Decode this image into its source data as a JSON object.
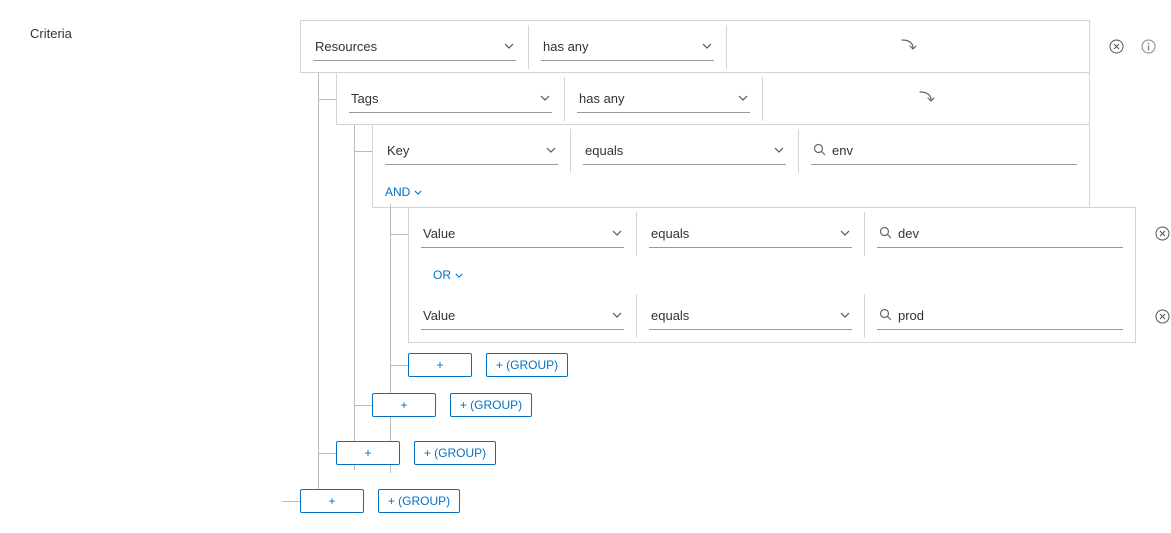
{
  "labels": {
    "criteria": "Criteria"
  },
  "level0": {
    "attribute": "Resources",
    "operator": "has any"
  },
  "level1": {
    "attribute": "Tags",
    "operator": "has any"
  },
  "level2": {
    "attribute": "Key",
    "operator": "equals",
    "value": "env",
    "logic": "AND"
  },
  "level3": {
    "row1": {
      "attribute": "Value",
      "operator": "equals",
      "value": "dev"
    },
    "logic": "OR",
    "row2": {
      "attribute": "Value",
      "operator": "equals",
      "value": "prod"
    }
  },
  "buttons": {
    "plus": "+",
    "group": "+ (GROUP)"
  }
}
